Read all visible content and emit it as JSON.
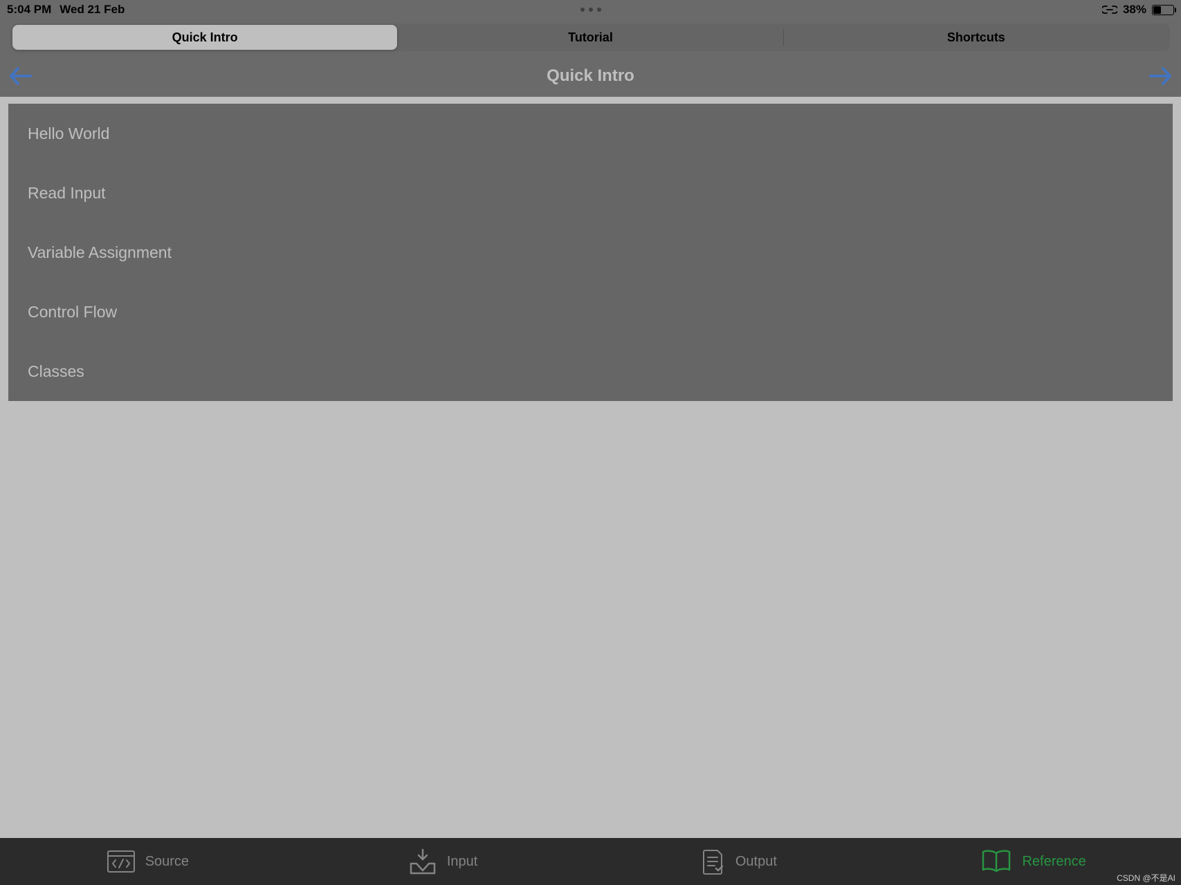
{
  "status": {
    "time": "5:04 PM",
    "date": "Wed 21 Feb",
    "battery_pct": "38%"
  },
  "segmented": {
    "items": [
      {
        "label": "Quick Intro",
        "active": true
      },
      {
        "label": "Tutorial",
        "active": false
      },
      {
        "label": "Shortcuts",
        "active": false
      }
    ]
  },
  "nav": {
    "title": "Quick Intro"
  },
  "list": {
    "items": [
      {
        "label": "Hello World"
      },
      {
        "label": "Read Input"
      },
      {
        "label": "Variable Assignment"
      },
      {
        "label": "Control Flow"
      },
      {
        "label": "Classes"
      }
    ]
  },
  "tabs": {
    "items": [
      {
        "label": "Source",
        "icon": "code-icon",
        "active": false
      },
      {
        "label": "Input",
        "icon": "input-icon",
        "active": false
      },
      {
        "label": "Output",
        "icon": "output-icon",
        "active": false
      },
      {
        "label": "Reference",
        "icon": "book-icon",
        "active": true
      }
    ]
  },
  "watermark": "CSDN @不是AI"
}
